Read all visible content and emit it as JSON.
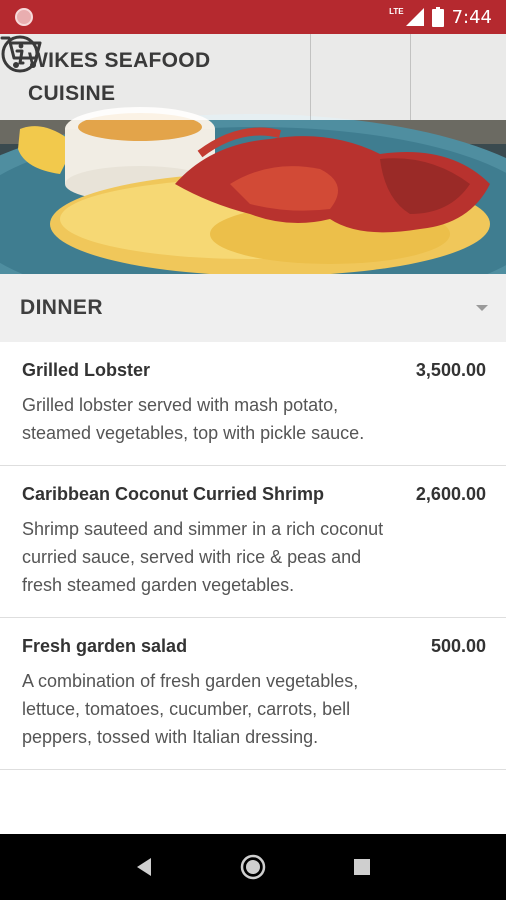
{
  "status_bar": {
    "network": "LTE",
    "time": "7:44"
  },
  "header": {
    "title": "WIKES SEAFOOD CUISINE",
    "info_icon": "info-icon",
    "cart_icon": "cart-icon"
  },
  "category": {
    "selected": "DINNER"
  },
  "menu": {
    "items": [
      {
        "name": "Grilled Lobster",
        "price": "3,500.00",
        "description": "Grilled lobster served with mash potato, steamed vegetables, top with pickle sauce."
      },
      {
        "name": "Caribbean Coconut Curried Shrimp",
        "price": "2,600.00",
        "description": "Shrimp sauteed and simmer in a rich coconut curried sauce, served with rice & peas and fresh steamed garden vegetables."
      },
      {
        "name": "Fresh garden salad",
        "price": "500.00",
        "description": "A combination of fresh garden vegetables, lettuce, tomatoes, cucumber, carrots, bell peppers, tossed with Italian dressing."
      }
    ]
  },
  "colors": {
    "status_bar": "#b5292f",
    "category_bg": "#efefef",
    "nav_bar": "#000000"
  }
}
